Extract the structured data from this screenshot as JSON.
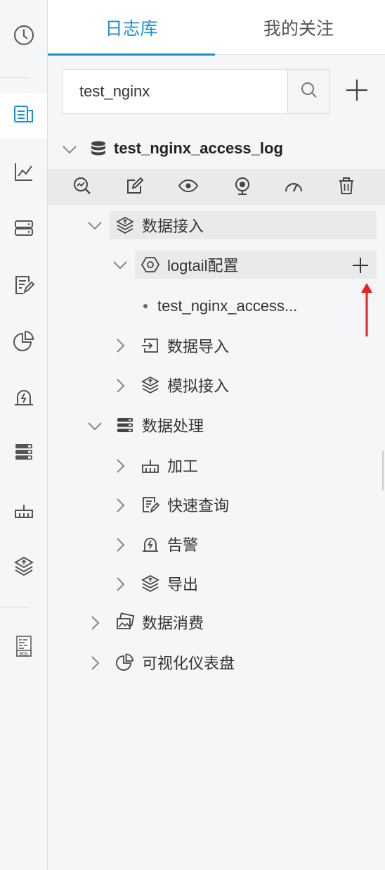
{
  "tabs": {
    "logstore": "日志库",
    "favorites": "我的关注"
  },
  "search": {
    "value": "test_nginx",
    "placeholder": ""
  },
  "project": {
    "name": "test_nginx_access_log"
  },
  "toolbar_icons": [
    "search-chart-icon",
    "edit-icon",
    "eye-icon",
    "webcam-icon",
    "gauge-icon",
    "trash-icon"
  ],
  "tree": {
    "data_ingest": "数据接入",
    "logtail_config": "logtail配置",
    "logtail_item": "test_nginx_access...",
    "data_import": "数据导入",
    "mock_ingest": "模拟接入",
    "data_processing": "数据处理",
    "transform": "加工",
    "quick_query": "快速查询",
    "alert": "告警",
    "export": "导出",
    "data_consume": "数据消费",
    "dashboards": "可视化仪表盘"
  },
  "rail_icons": [
    "clock-icon",
    "logstore-icon",
    "line-chart-icon",
    "server-icon",
    "query-icon",
    "pie-chart-icon",
    "alert-icon",
    "list-icon",
    "transform-icon",
    "layers-icon",
    "sql-icon"
  ],
  "colors": {
    "accent": "#1b8fd6",
    "annotation_arrow": "#e8231d"
  }
}
